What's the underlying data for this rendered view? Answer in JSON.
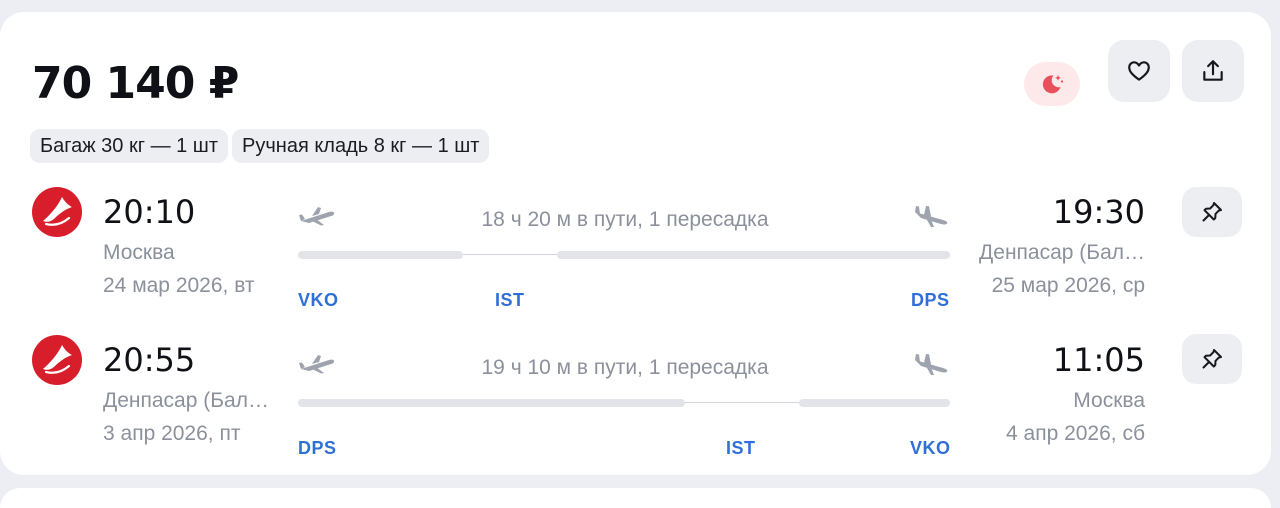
{
  "price": "70 140 ₽",
  "baggage": [
    {
      "label": "Багаж 30 кг — 1 шт"
    },
    {
      "label": "Ручная кладь 8 кг — 1 шт"
    }
  ],
  "colors": {
    "accent": "#2f6fd6",
    "airline": "#d81e2b",
    "night": "#e8505b"
  },
  "actions": {
    "night_icon": "moon-stars-icon",
    "favorite_icon": "heart-icon",
    "share_icon": "share-icon"
  },
  "segments": [
    {
      "airline_logo": "turkish-airlines-logo",
      "depart_time": "20:10",
      "depart_city": "Москва",
      "depart_date": "24 мар 2026, вт",
      "duration": "18 ч 20 м в пути, 1 пересадка",
      "from_code": "VKO",
      "via_code": "IST",
      "to_code": "DPS",
      "arrive_time": "19:30",
      "arrive_city": "Денпасар (Бал…",
      "arrive_date": "25 мар 2026, ср",
      "pin_icon": "pin-icon"
    },
    {
      "airline_logo": "turkish-airlines-logo",
      "depart_time": "20:55",
      "depart_city": "Денпасар (Бал…",
      "depart_date": "3 апр 2026, пт",
      "duration": "19 ч 10 м в пути, 1 пересадка",
      "from_code": "DPS",
      "via_code": "IST",
      "to_code": "VKO",
      "arrive_time": "11:05",
      "arrive_city": "Москва",
      "arrive_date": "4 апр 2026, сб",
      "pin_icon": "pin-icon"
    }
  ]
}
